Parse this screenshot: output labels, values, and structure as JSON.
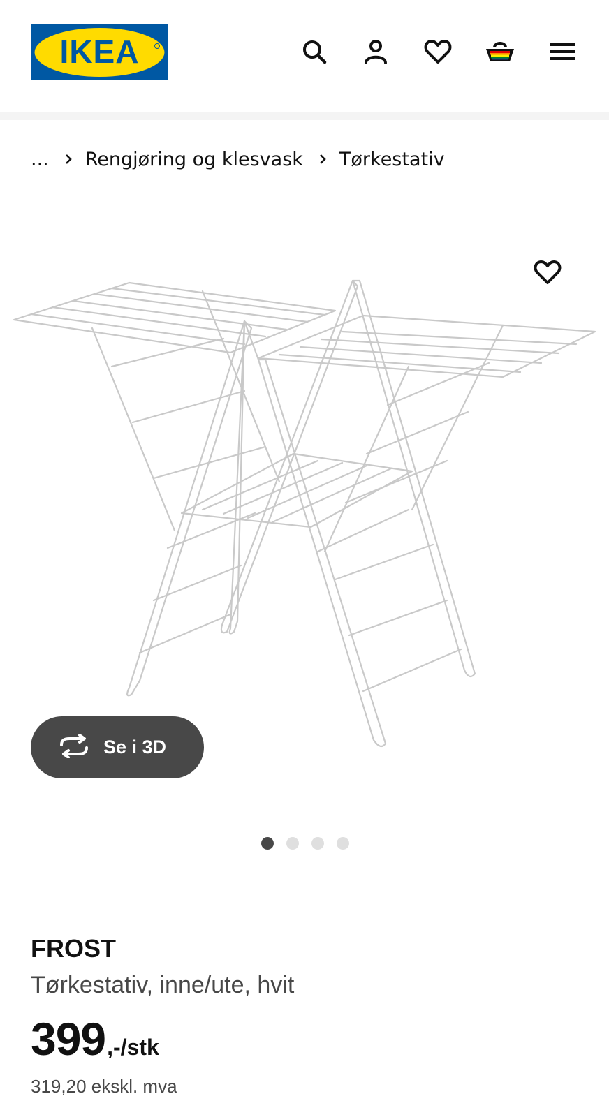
{
  "header": {
    "logo_text": "IKEA",
    "icons": [
      "search-icon",
      "user-icon",
      "heart-icon",
      "shopping-basket-icon",
      "hamburger-menu-icon"
    ]
  },
  "breadcrumb": {
    "ellipsis": "...",
    "items": [
      "Rengjøring og klesvask",
      "Tørkestativ"
    ]
  },
  "gallery": {
    "view_3d_label": "Se i 3D",
    "slides_total": 4,
    "active_slide": 1
  },
  "product": {
    "name": "FROST",
    "description": "Tørkestativ, inne/ute, hvit",
    "price_amount": "399",
    "price_suffix": ",-/stk",
    "price_excl_vat": "319,20 ekskl. mva"
  },
  "colors": {
    "ikea_blue": "#0058a3",
    "ikea_yellow": "#ffdb00",
    "button_dark": "#484848",
    "dot_inactive": "#dfdfdf"
  }
}
